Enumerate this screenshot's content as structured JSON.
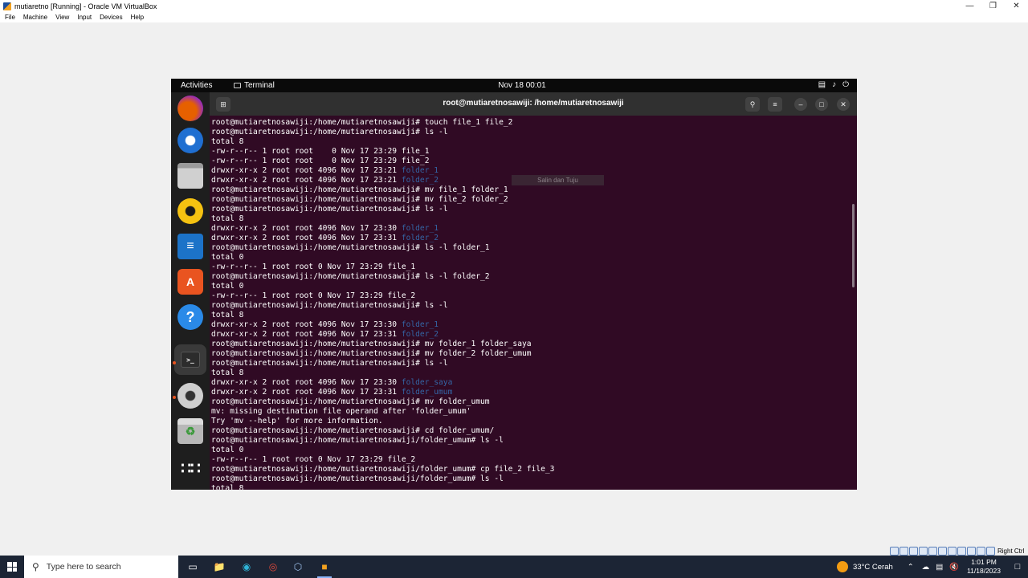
{
  "vbox": {
    "title": "mutiaretno [Running] - Oracle VM VirtualBox",
    "menu": [
      "File",
      "Machine",
      "View",
      "Input",
      "Devices",
      "Help"
    ],
    "host_key": "Right Ctrl"
  },
  "gnome": {
    "activities": "Activities",
    "app_name": "Terminal",
    "clock": "Nov 18  00:01"
  },
  "dock": [
    "firefox-icon",
    "thunderbird-icon",
    "files-icon",
    "rhythmbox-icon",
    "writer-icon",
    "software-icon",
    "help-icon",
    "terminal-icon",
    "settings-icon",
    "trash-icon",
    "app-grid-icon"
  ],
  "terminal": {
    "title": "root@mutiaretnosawiji: /home/mutiaretnosawiji",
    "tooltip": "Salin dan Tuju",
    "lines": [
      {
        "text": "root@mutiaretnosawiji:/home/mutiaretnosawiji# touch file_1 file_2",
        "dir": ""
      },
      {
        "text": "root@mutiaretnosawiji:/home/mutiaretnosawiji# ls -l",
        "dir": ""
      },
      {
        "text": "total 8",
        "dir": ""
      },
      {
        "text": "-rw-r--r-- 1 root root    0 Nov 17 23:29 file_1",
        "dir": ""
      },
      {
        "text": "-rw-r--r-- 1 root root    0 Nov 17 23:29 file_2",
        "dir": ""
      },
      {
        "text": "drwxr-xr-x 2 root root 4096 Nov 17 23:21 ",
        "dir": "folder_1"
      },
      {
        "text": "drwxr-xr-x 2 root root 4096 Nov 17 23:21 ",
        "dir": "folder_2"
      },
      {
        "text": "root@mutiaretnosawiji:/home/mutiaretnosawiji# mv file_1 folder_1",
        "dir": ""
      },
      {
        "text": "root@mutiaretnosawiji:/home/mutiaretnosawiji# mv file_2 folder_2",
        "dir": ""
      },
      {
        "text": "root@mutiaretnosawiji:/home/mutiaretnosawiji# ls -l",
        "dir": ""
      },
      {
        "text": "total 8",
        "dir": ""
      },
      {
        "text": "drwxr-xr-x 2 root root 4096 Nov 17 23:30 ",
        "dir": "folder_1"
      },
      {
        "text": "drwxr-xr-x 2 root root 4096 Nov 17 23:31 ",
        "dir": "folder_2"
      },
      {
        "text": "root@mutiaretnosawiji:/home/mutiaretnosawiji# ls -l folder_1",
        "dir": ""
      },
      {
        "text": "total 0",
        "dir": ""
      },
      {
        "text": "-rw-r--r-- 1 root root 0 Nov 17 23:29 file_1",
        "dir": ""
      },
      {
        "text": "root@mutiaretnosawiji:/home/mutiaretnosawiji# ls -l folder_2",
        "dir": ""
      },
      {
        "text": "total 0",
        "dir": ""
      },
      {
        "text": "-rw-r--r-- 1 root root 0 Nov 17 23:29 file_2",
        "dir": ""
      },
      {
        "text": "root@mutiaretnosawiji:/home/mutiaretnosawiji# ls -l",
        "dir": ""
      },
      {
        "text": "total 8",
        "dir": ""
      },
      {
        "text": "drwxr-xr-x 2 root root 4096 Nov 17 23:30 ",
        "dir": "folder_1"
      },
      {
        "text": "drwxr-xr-x 2 root root 4096 Nov 17 23:31 ",
        "dir": "folder_2"
      },
      {
        "text": "root@mutiaretnosawiji:/home/mutiaretnosawiji# mv folder_1 folder_saya",
        "dir": ""
      },
      {
        "text": "root@mutiaretnosawiji:/home/mutiaretnosawiji# mv folder_2 folder_umum",
        "dir": ""
      },
      {
        "text": "root@mutiaretnosawiji:/home/mutiaretnosawiji# ls -l",
        "dir": ""
      },
      {
        "text": "total 8",
        "dir": ""
      },
      {
        "text": "drwxr-xr-x 2 root root 4096 Nov 17 23:30 ",
        "dir": "folder_saya"
      },
      {
        "text": "drwxr-xr-x 2 root root 4096 Nov 17 23:31 ",
        "dir": "folder_umum"
      },
      {
        "text": "root@mutiaretnosawiji:/home/mutiaretnosawiji# mv folder_umum",
        "dir": ""
      },
      {
        "text": "mv: missing destination file operand after 'folder_umum'",
        "dir": ""
      },
      {
        "text": "Try 'mv --help' for more information.",
        "dir": ""
      },
      {
        "text": "root@mutiaretnosawiji:/home/mutiaretnosawiji# cd folder_umum/",
        "dir": ""
      },
      {
        "text": "root@mutiaretnosawiji:/home/mutiaretnosawiji/folder_umum# ls -l",
        "dir": ""
      },
      {
        "text": "total 0",
        "dir": ""
      },
      {
        "text": "-rw-r--r-- 1 root root 0 Nov 17 23:29 file_2",
        "dir": ""
      },
      {
        "text": "root@mutiaretnosawiji:/home/mutiaretnosawiji/folder_umum# cp file_2 file_3",
        "dir": ""
      },
      {
        "text": "root@mutiaretnosawiji:/home/mutiaretnosawiji/folder_umum# ls -l",
        "dir": ""
      },
      {
        "text": "total 8",
        "dir": ""
      }
    ]
  },
  "taskbar": {
    "search_placeholder": "Type here to search",
    "weather": "33°C  Cerah",
    "time": "1:01 PM",
    "date": "11/18/2023"
  },
  "colors": {
    "terminal_bg": "#300a24",
    "dir_color": "#3465a4",
    "ubuntu_orange": "#e95420"
  }
}
